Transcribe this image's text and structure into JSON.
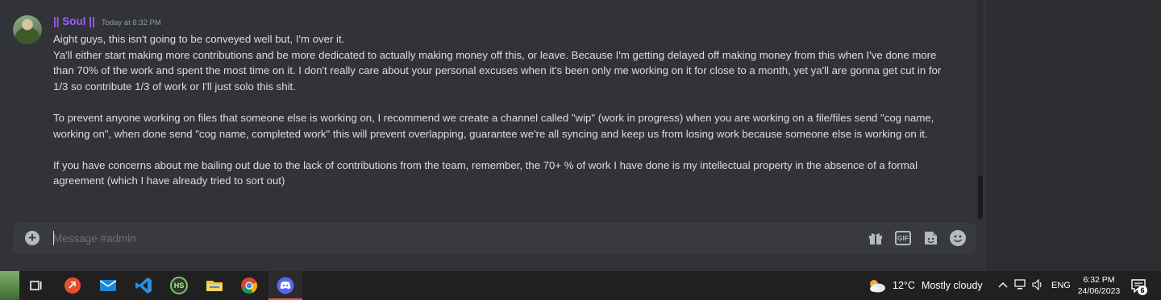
{
  "message": {
    "username": "|| Soul ||",
    "timestamp": "Today at 6:32 PM",
    "line1": "Aight guys, this isn't going to be conveyed well but, I'm over it.",
    "para1": "Ya'll either start making more contributions and be more dedicated to actually making money off this, or leave. Because I'm getting delayed off making money from this when I've done more than 70% of the work and spent the most time on it. I don't really care about your personal excuses when it's been only me working on it for close to a month, yet ya'll are gonna get cut in for 1/3 so contribute 1/3 of work or I'll just solo this shit.",
    "para2": "To prevent anyone working on files that someone else is working on, I recommend we create a channel called \"wip\" (work in progress) when you are working on a file/files send \"cog name, working on\", when done send \"cog name, completed work\" this will prevent overlapping, guarantee we're all syncing and keep us from losing work because someone else is working on it.",
    "para3": "If you have concerns about me bailing out due to the lack of contributions from the team, remember, the 70+ % of work I have done is my intellectual property in the absence of a formal agreement (which I have already tried to sort out)"
  },
  "composer": {
    "placeholder": "Message #admin",
    "gif_label": "GIF",
    "icons": [
      "plus-circle-icon",
      "gift-icon",
      "gif-icon",
      "sticker-icon",
      "emoji-icon"
    ]
  },
  "taskbar": {
    "apps": [
      "task-view-icon",
      "app-red-icon",
      "mail-icon",
      "vscode-icon",
      "hs-icon",
      "file-explorer-icon",
      "chrome-icon",
      "discord-icon"
    ],
    "hs_label": "HS",
    "weather": {
      "temp": "12°C",
      "condition": "Mostly cloudy"
    },
    "language": "ENG",
    "time": "6:32 PM",
    "date": "24/06/2023",
    "notification_count": "6"
  },
  "colors": {
    "username": "#a05bff",
    "background": "#313338",
    "composer": "#383a40",
    "taskbar": "#202020"
  }
}
